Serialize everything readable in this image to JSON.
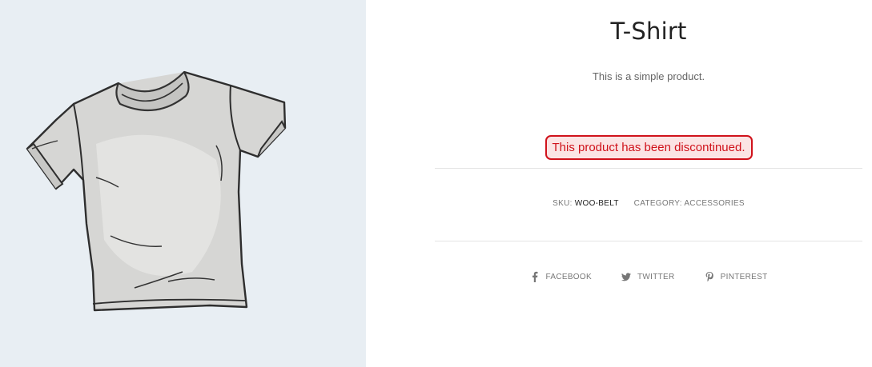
{
  "product": {
    "title": "T-Shirt",
    "short_description": "This is a simple product.",
    "notice": "This product has been discontinued.",
    "image_alt_icon": "t-shirt-image"
  },
  "meta": {
    "sku_label": "SKU:",
    "sku_value": "WOO-BELT",
    "category_label": "CATEGORY:",
    "category_value": "ACCESSORIES"
  },
  "share": [
    {
      "label": "FACEBOOK",
      "icon": "facebook-icon"
    },
    {
      "label": "TWITTER",
      "icon": "twitter-icon"
    },
    {
      "label": "PINTEREST",
      "icon": "pinterest-icon"
    }
  ],
  "colors": {
    "image_background": "#e8eef3",
    "notice_border": "#d0121b",
    "notice_background": "#fbe4e4"
  }
}
